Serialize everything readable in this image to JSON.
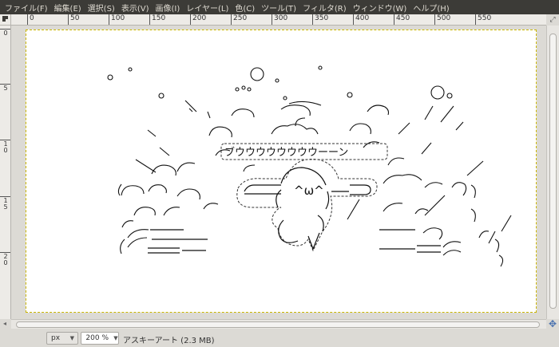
{
  "menu": [
    "ファイル(F)",
    "編集(E)",
    "選択(S)",
    "表示(V)",
    "画像(I)",
    "レイヤー(L)",
    "色(C)",
    "ツール(T)",
    "フィルタ(R)",
    "ウィンドウ(W)",
    "ヘルプ(H)"
  ],
  "ruler": {
    "h_labels": [
      "0",
      "50",
      "100",
      "150",
      "200",
      "250",
      "300",
      "350",
      "400",
      "450",
      "500",
      "550"
    ],
    "v_labels": [
      "0",
      "5",
      "1\n0",
      "1\n5",
      "2\n0"
    ]
  },
  "canvas": {
    "speech": "ブウウウウウウウウーーン",
    "face": "^ω^",
    "ascii_lines": [
      "o   °",
      "o  ‘、＼ r‐、 ,ｒ‐､   o  r‐ ./,  / ／,",
      "、  ヽ,r‐ヽ  ．((‐‐)))   /‐ヽ ,  ,",
      "＼ ヽ‐r‐ヽ ‐‐ヽ       ／",
      "((‐ヽ(;;‐(‐‐    ‐‐‐‐ヽ;;;;))‐)",
      "(;;(‐‐‐(;;;(          ))‐));;;)‐‐)",
      "ヾ(‐‐‐ニ‐‐         ‐ニ‐‐)ノ;;ノ;;;‐)",
      "((‐≡ニ‐.            ‐ニ≡‐)ノ;;ノノ"
    ]
  },
  "status": {
    "unit": "px",
    "zoom": "200 %",
    "info": "アスキーアート (2.3 MB)"
  }
}
